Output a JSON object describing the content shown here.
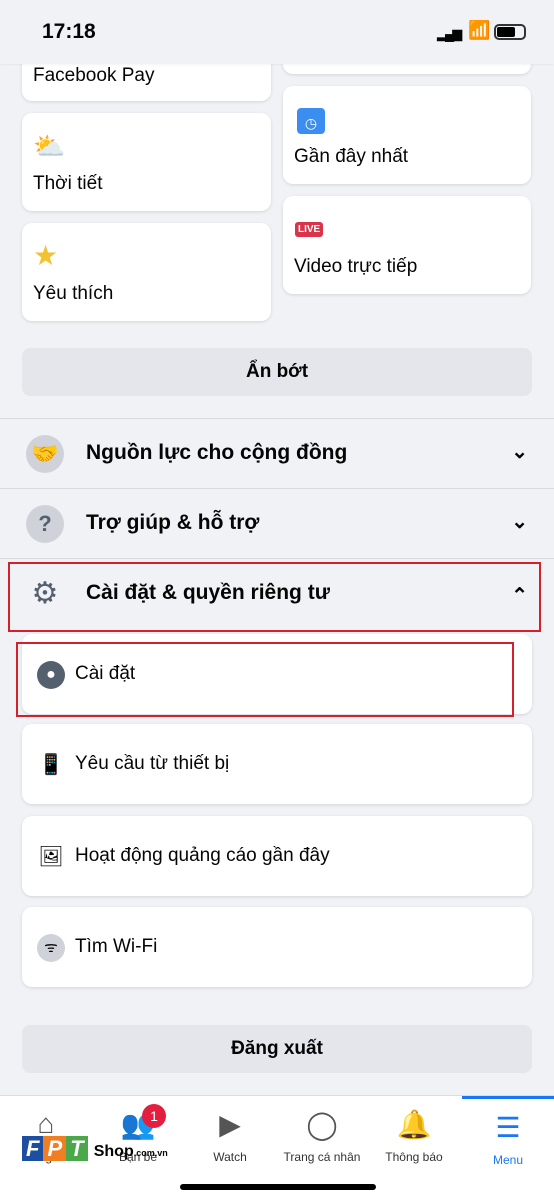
{
  "status_bar": {
    "time": "17:18"
  },
  "shortcuts": {
    "left": [
      {
        "label": "Facebook Pay"
      },
      {
        "label": "Thời tiết",
        "icon": "weather-icon"
      },
      {
        "label": "Yêu thích",
        "icon": "star-icon"
      }
    ],
    "right": [
      {
        "label": ""
      },
      {
        "label": "Gần đây nhất",
        "icon": "recent-icon"
      },
      {
        "label": "Video trực tiếp",
        "icon": "live-icon",
        "badge": "LIVE"
      }
    ]
  },
  "see_less": "Ẩn bớt",
  "sections": [
    {
      "label": "Nguồn lực cho cộng đồng",
      "icon": "handshake-icon",
      "expanded": false
    },
    {
      "label": "Trợ giúp & hỗ trợ",
      "icon": "help-icon",
      "expanded": false
    },
    {
      "label": "Cài đặt & quyền riêng tư",
      "icon": "gear-icon",
      "expanded": true
    }
  ],
  "settings_items": [
    {
      "label": "Cài đặt",
      "icon": "profile-icon"
    },
    {
      "label": "Yêu cầu từ thiết bị",
      "icon": "device-icon"
    },
    {
      "label": "Hoạt động quảng cáo gần đây",
      "icon": "ad-activity-icon"
    },
    {
      "label": "Tìm Wi-Fi",
      "icon": "wifi-icon"
    }
  ],
  "logout": "Đăng xuất",
  "nav": [
    {
      "label": "Bảng tin",
      "icon": "home-icon"
    },
    {
      "label": "Bạn bè",
      "icon": "friends-icon",
      "badge": "1"
    },
    {
      "label": "Watch",
      "icon": "watch-icon"
    },
    {
      "label": "Trang cá nhân",
      "icon": "profile-icon"
    },
    {
      "label": "Thông báo",
      "icon": "bell-icon"
    },
    {
      "label": "Menu",
      "icon": "menu-icon",
      "active": true
    }
  ],
  "watermark": {
    "logo": "FPT Shop .com.vn"
  },
  "colors": {
    "accent": "#1877f2",
    "highlight": "#d3202a",
    "badge": "#e41e3f"
  }
}
